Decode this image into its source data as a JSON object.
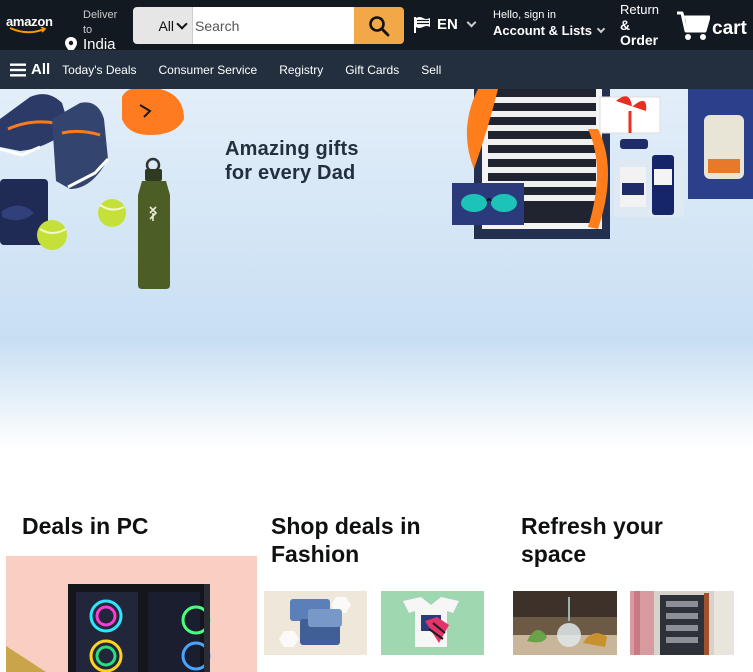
{
  "header": {
    "logo_text": "amazon",
    "deliver_line1": "Deliver",
    "deliver_line2": "to",
    "deliver_location": "India",
    "search_category": "All",
    "search_placeholder": "Search",
    "language": "EN",
    "account_greeting": "Hello, sign in",
    "account_label": "Account & Lists",
    "orders_line1": "Return",
    "orders_line2": "&",
    "orders_line3": "Order",
    "cart_label": "cart"
  },
  "subnav": {
    "all_label": "All",
    "items": [
      "Today's Deals",
      "Consumer Service",
      "Registry",
      "Gift Cards",
      "Sell"
    ]
  },
  "hero": {
    "headline_line1": "Amazing gifts",
    "headline_line2": "for every Dad"
  },
  "cards": [
    {
      "title": "Deals in PC"
    },
    {
      "title_line1": "Shop deals in",
      "title_line2": "Fashion"
    },
    {
      "title_line1": "Refresh your",
      "title_line2": "space"
    }
  ],
  "colors": {
    "nav_dark": "#131921",
    "nav_secondary": "#232f3e",
    "search_button": "#f3a847",
    "accent_orange": "#ff9900"
  }
}
